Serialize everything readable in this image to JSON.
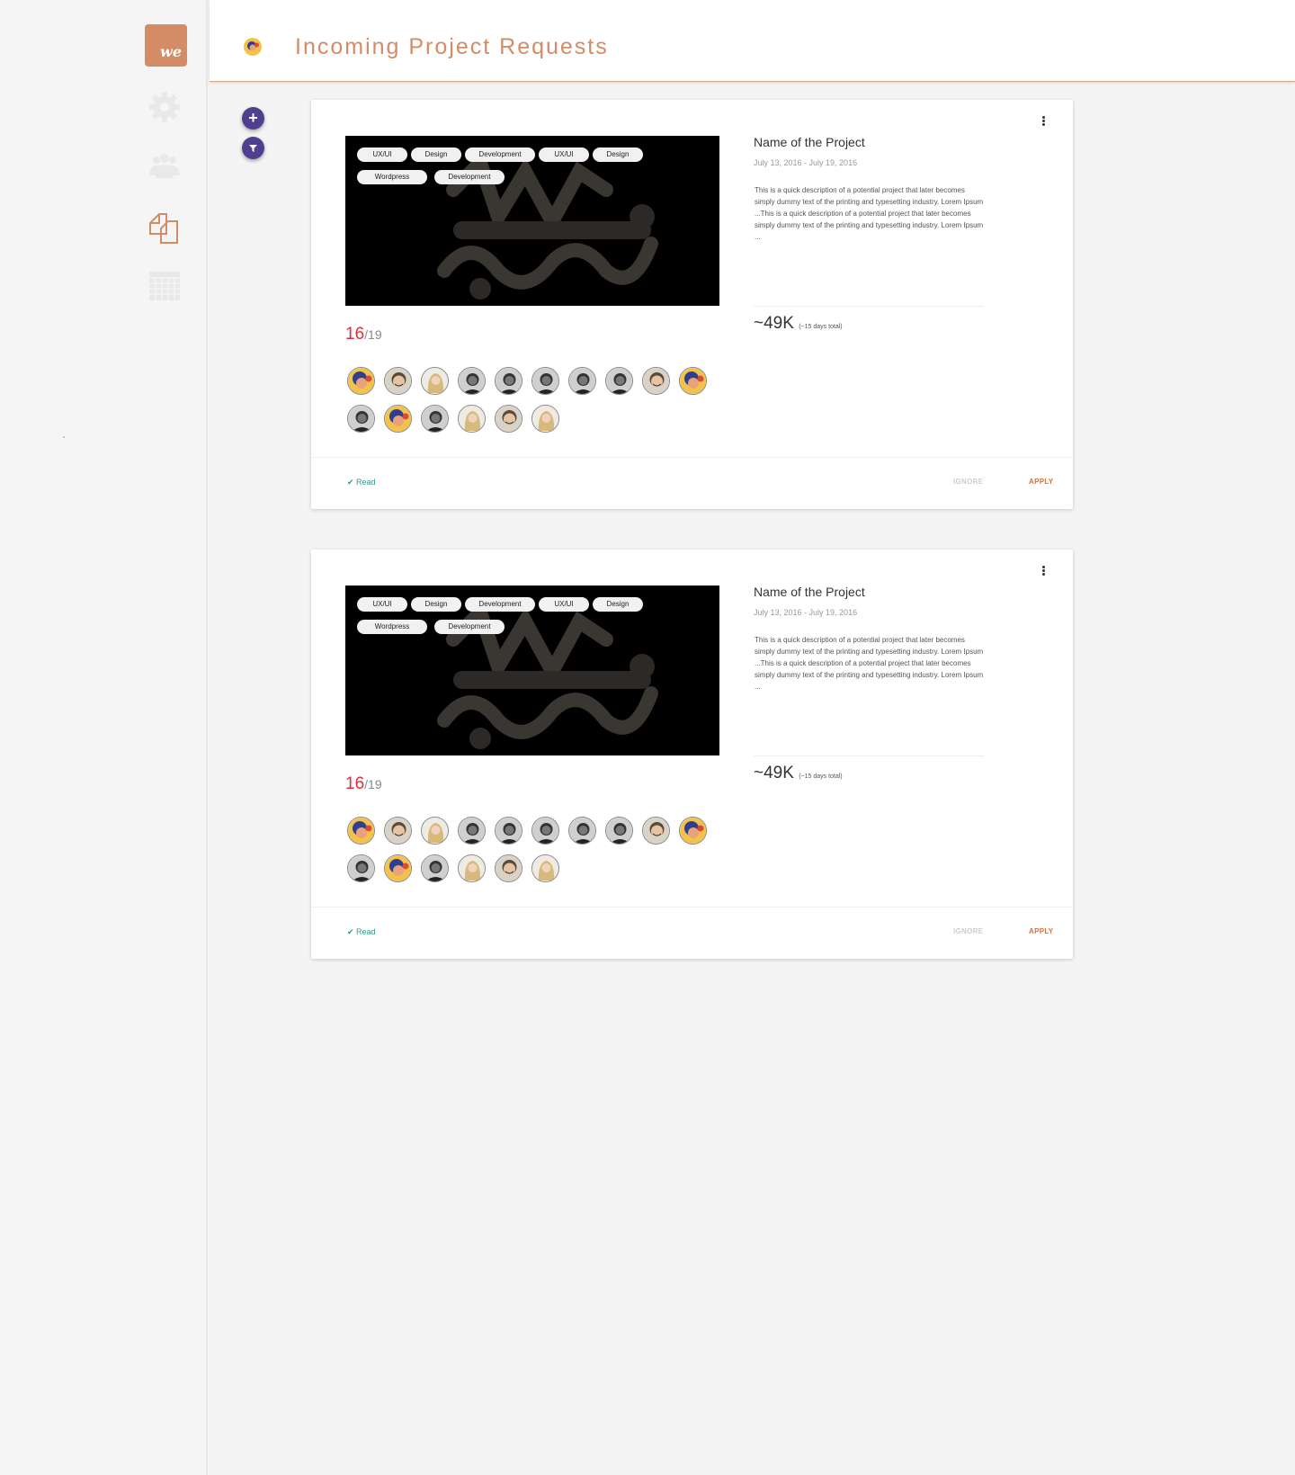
{
  "app": {
    "logo_text": "we",
    "page_title": "Incoming Project Requests",
    "nav": [
      {
        "icon": "gear-icon"
      },
      {
        "icon": "people-icon"
      },
      {
        "icon": "documents-icon",
        "active": true
      },
      {
        "icon": "calendar-icon"
      }
    ],
    "fab_add": "+",
    "colors": {
      "accent": "#d38c66",
      "fab": "#4f3f8f",
      "read": "#2a9d8f",
      "apply": "#d3733d",
      "count": "#e02b3c"
    }
  },
  "cards": [
    {
      "tags": [
        "UX/UI",
        "Design",
        "Development",
        "UX/UI",
        "Design",
        "Wordpress",
        "Development"
      ],
      "count": "16",
      "total": "/19",
      "name": "Name of the Project",
      "dates": "July 13, 2016 - July 19, 2016",
      "description": "This is a quick description of a potential project that later becomes simply dummy text of the printing and typesetting industry. Lorem Ipsum ...This is a quick description of a potential project that later becomes simply dummy text of the printing and typesetting industry. Lorem Ipsum ...",
      "budget": "~49K",
      "budget_note": "(~15 days total)",
      "read": "✔ Read",
      "ignore": "IGNORE",
      "apply": "APPLY"
    },
    {
      "tags": [
        "UX/UI",
        "Design",
        "Development",
        "UX/UI",
        "Design",
        "Wordpress",
        "Development"
      ],
      "count": "16",
      "total": "/19",
      "name": "Name of the Project",
      "dates": "July 13, 2016 - July 19, 2016",
      "description": "This is a quick description of a potential project that later becomes simply dummy text of the printing and typesetting industry. Lorem Ipsum ...This is a quick description of a potential project that later becomes simply dummy text of the printing and typesetting industry. Lorem Ipsum ...",
      "budget": "~49K",
      "budget_note": "(~15 days total)",
      "read": "✔ Read",
      "ignore": "IGNORE",
      "apply": "APPLY"
    }
  ]
}
